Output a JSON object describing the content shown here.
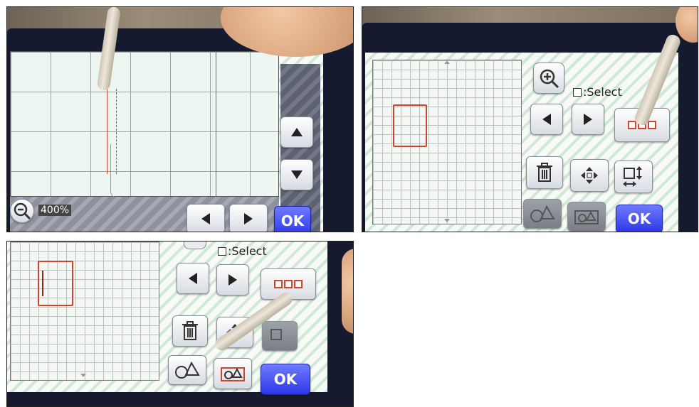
{
  "panel1": {
    "zoom_label": "400%",
    "ok_label": "OK",
    "icons": [
      "zoom-out-icon",
      "arrow-up-icon",
      "arrow-down-icon",
      "arrow-left-icon",
      "arrow-right-icon"
    ]
  },
  "panel2": {
    "select_label": ":Select",
    "ok_label": "OK",
    "icons": [
      "zoom-in-icon",
      "arrow-left-icon",
      "arrow-right-icon",
      "select-all-icon",
      "trash-icon",
      "move-icon",
      "resize-icon",
      "shapes-icon",
      "shapes-frame-icon"
    ]
  },
  "panel3": {
    "select_label": ":Select",
    "ok_label": "OK",
    "icons": [
      "arrow-left-icon",
      "arrow-right-icon",
      "select-all-icon",
      "trash-icon",
      "move-icon",
      "shapes-icon",
      "shapes-frame-icon"
    ]
  },
  "colors": {
    "accent_ok": "#3a43f0",
    "selection_red": "#c8462e",
    "screen_stripe": "#cfe9d6"
  }
}
